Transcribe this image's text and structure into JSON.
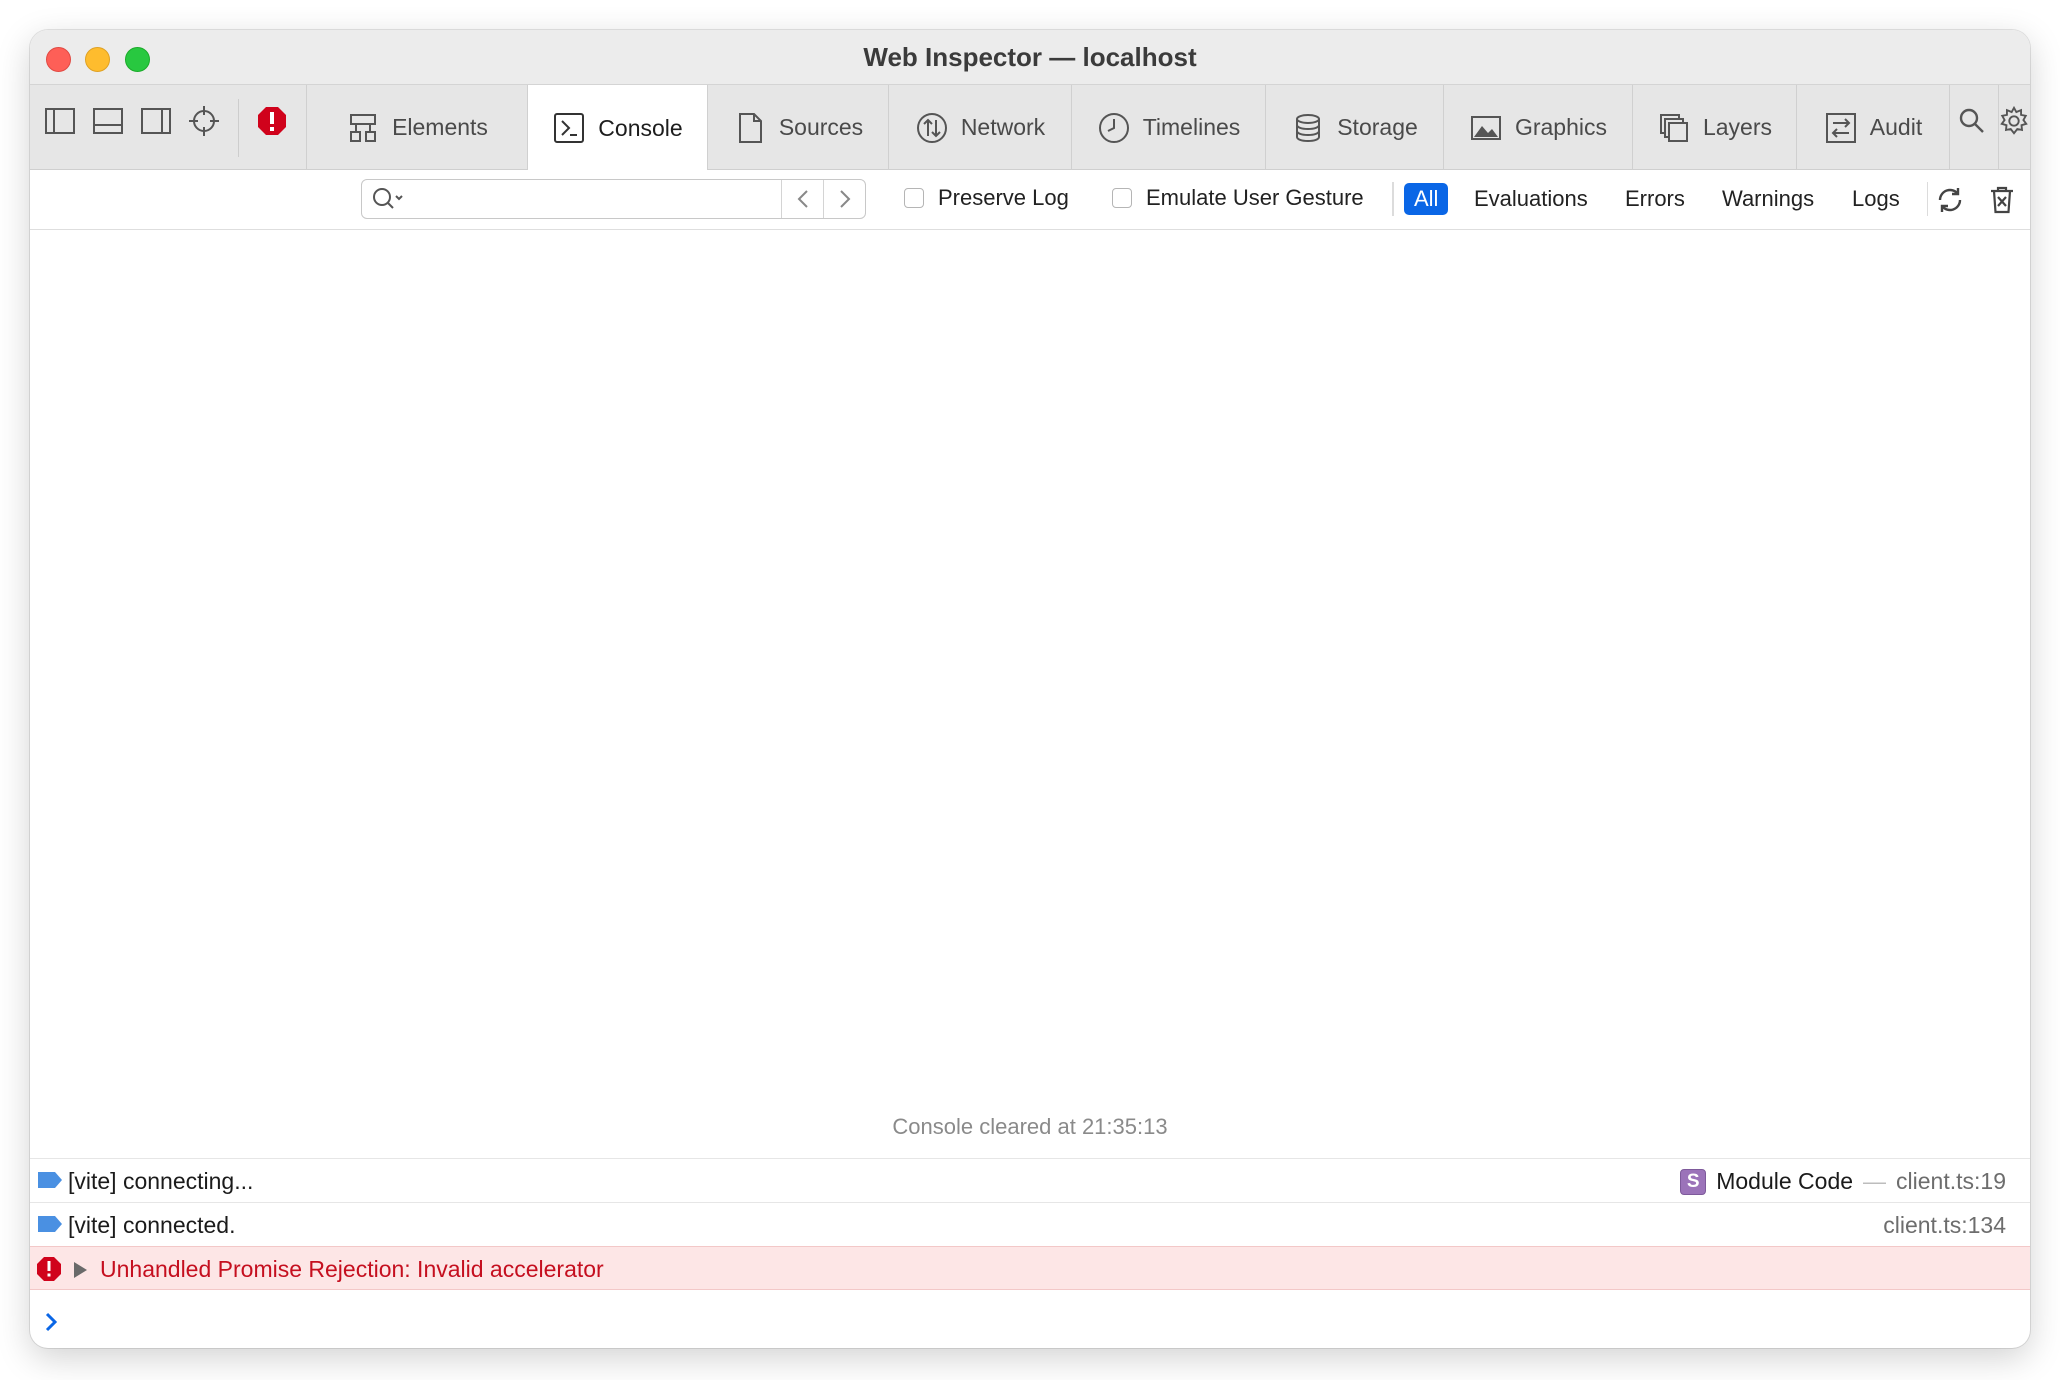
{
  "window": {
    "title": "Web Inspector — localhost"
  },
  "tabs": [
    {
      "label": "Elements",
      "icon": "elements-icon"
    },
    {
      "label": "Console",
      "icon": "console-icon",
      "active": true
    },
    {
      "label": "Sources",
      "icon": "sources-icon"
    },
    {
      "label": "Network",
      "icon": "network-icon"
    },
    {
      "label": "Timelines",
      "icon": "timelines-icon"
    },
    {
      "label": "Storage",
      "icon": "storage-icon"
    },
    {
      "label": "Graphics",
      "icon": "graphics-icon"
    },
    {
      "label": "Layers",
      "icon": "layers-icon"
    },
    {
      "label": "Audit",
      "icon": "audit-icon"
    }
  ],
  "filterbar": {
    "search_value": "",
    "preserve_log": {
      "label": "Preserve Log",
      "checked": false
    },
    "emulate_gesture": {
      "label": "Emulate User Gesture",
      "checked": false
    },
    "levels": [
      "All",
      "Evaluations",
      "Errors",
      "Warnings",
      "Logs"
    ],
    "active_level": "All"
  },
  "console": {
    "cleared_text": "Console cleared at 21:35:13",
    "messages": [
      {
        "type": "log",
        "text": "[vite] connecting...",
        "badge": "S",
        "context": "Module Code",
        "separator": "—",
        "source": "client.ts:19"
      },
      {
        "type": "log",
        "text": "[vite] connected.",
        "source": "client.ts:134"
      },
      {
        "type": "error",
        "text": "Unhandled Promise Rejection: Invalid accelerator"
      }
    ]
  },
  "colors": {
    "accent": "#0a66e6",
    "error_text": "#c50f1f",
    "error_bg": "#fde6e6",
    "log_marker": "#4a90e2"
  }
}
